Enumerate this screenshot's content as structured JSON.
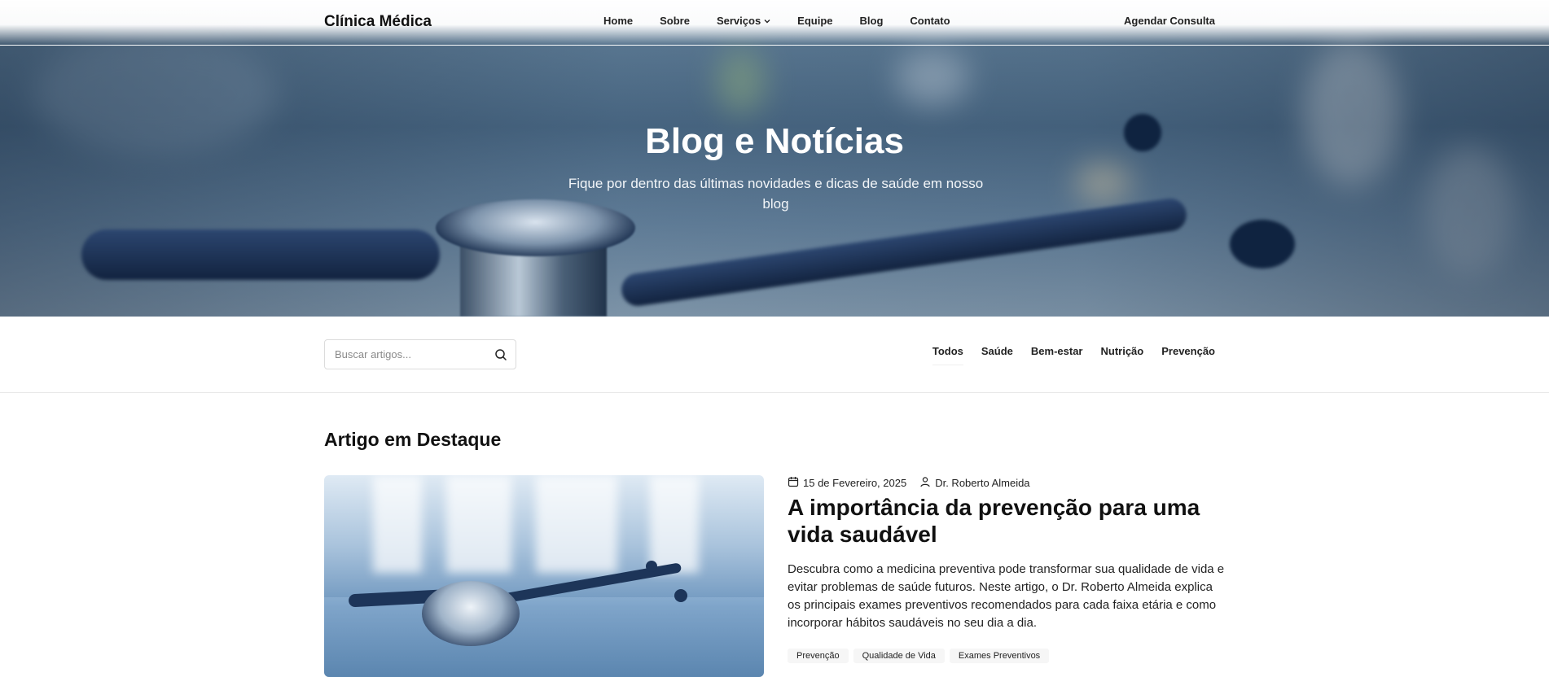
{
  "nav": {
    "brand": "Clínica Médica",
    "items": [
      "Home",
      "Sobre",
      "Serviços",
      "Equipe",
      "Blog",
      "Contato"
    ],
    "cta": "Agendar Consulta"
  },
  "hero": {
    "title": "Blog e Notícias",
    "subtitle": "Fique por dentro das últimas novidades e dicas de saúde em nosso blog"
  },
  "filter": {
    "search_placeholder": "Buscar artigos...",
    "categories": [
      "Todos",
      "Saúde",
      "Bem-estar",
      "Nutrição",
      "Prevenção"
    ],
    "active_category": "Todos"
  },
  "featured": {
    "section_title": "Artigo em Destaque",
    "date": "15 de Fevereiro, 2025",
    "author": "Dr. Roberto Almeida",
    "title": "A importância da prevenção para uma vida saudável",
    "description": "Descubra como a medicina preventiva pode transformar sua qualidade de vida e evitar problemas de saúde futuros. Neste artigo, o Dr. Roberto Almeida explica os principais exames preventivos recomendados para cada faixa etária e como incorporar hábitos saudáveis no seu dia a dia.",
    "tags": [
      "Prevenção",
      "Qualidade de Vida",
      "Exames Preventivos"
    ]
  },
  "icons": {
    "search": "search-icon",
    "calendar": "calendar-icon",
    "user": "user-icon",
    "chevron": "chevron-down-icon"
  }
}
